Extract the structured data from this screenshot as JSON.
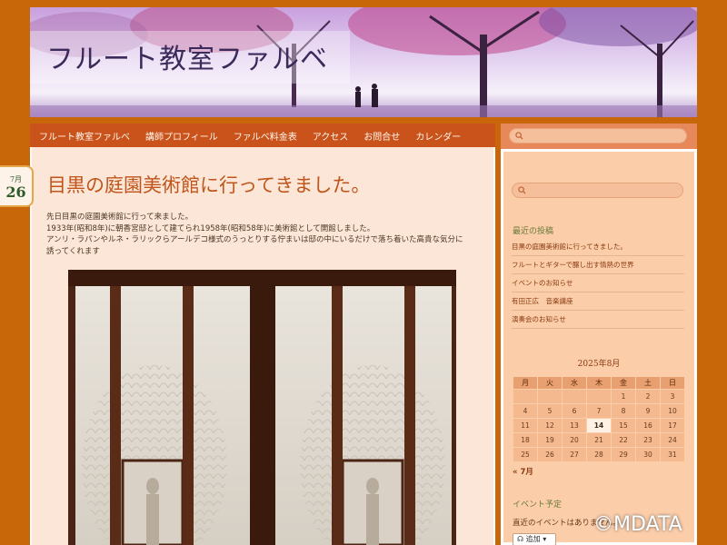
{
  "site": {
    "title": "フルート教室ファルベ"
  },
  "nav": {
    "items": [
      "フルート教室ファルベ",
      "講師プロフィール",
      "ファルベ料金表",
      "アクセス",
      "お問合せ",
      "カレンダー"
    ]
  },
  "post": {
    "date_month": "7月",
    "date_day": "26",
    "title": "目黒の庭園美術館に行ってきました。",
    "lines": [
      "先日目黒の庭園美術館に行って来ました。",
      "1933年(昭和8年)に朝香宮邸として建てられ1958年(昭和58年)に美術館として開館しました。",
      "アンリ・ラパンやルネ・ラリックらアールデコ様式のうっとりする佇まいは邸の中にいるだけで落ち着いた高貴な気分に",
      "誘ってくれます"
    ]
  },
  "sidebar": {
    "recent_title": "最近の投稿",
    "recent_posts": [
      "目黒の庭園美術館に行ってきました。",
      "フルートとギターで醸し出す情熱の世界",
      "イベントのお知らせ",
      "有田正広　音楽講座",
      "演奏会のお知らせ"
    ],
    "calendar": {
      "caption": "2025年8月",
      "weekdays": [
        "月",
        "火",
        "水",
        "木",
        "金",
        "土",
        "日"
      ],
      "weeks": [
        [
          "",
          "",
          "",
          "",
          "1",
          "2",
          "3"
        ],
        [
          "4",
          "5",
          "6",
          "7",
          "8",
          "9",
          "10"
        ],
        [
          "11",
          "12",
          "13",
          "14",
          "15",
          "16",
          "17"
        ],
        [
          "18",
          "19",
          "20",
          "21",
          "22",
          "23",
          "24"
        ],
        [
          "25",
          "26",
          "27",
          "28",
          "29",
          "30",
          "31"
        ]
      ],
      "today": "14",
      "prev_link": "« 7月"
    },
    "event_title": "イベント予定",
    "event_text": "直近のイベントはありません。",
    "add_button": "追加"
  },
  "watermark": "©MDATA",
  "colors": {
    "page_bg": "#c8670a",
    "nav_bg": "#c9531a",
    "title_color": "#c0541a",
    "content_bg": "#fce6d7",
    "sidebar_bg": "#fbcda9"
  }
}
